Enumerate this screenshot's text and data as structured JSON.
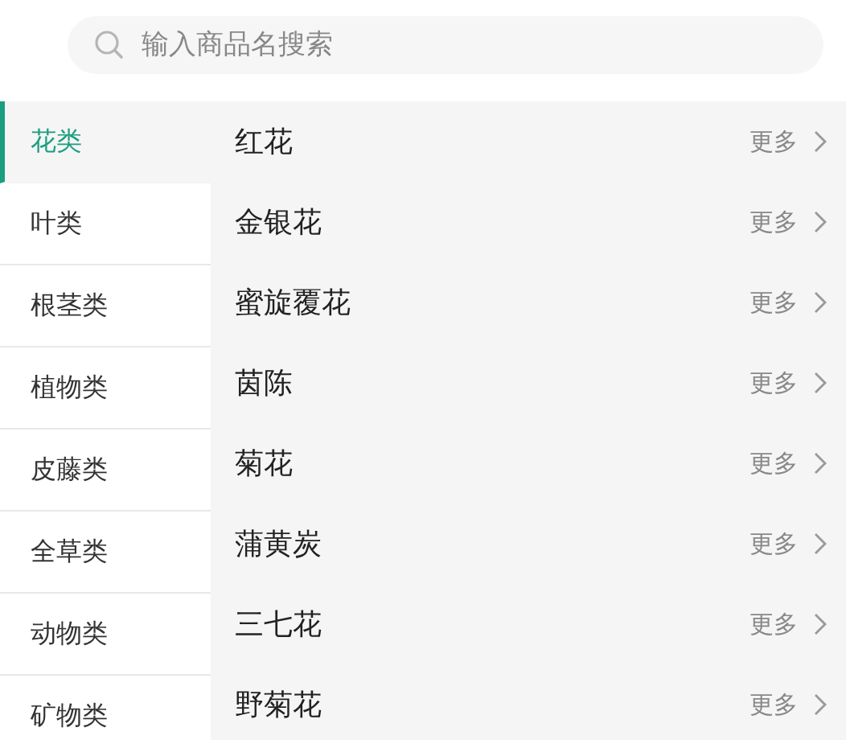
{
  "search": {
    "placeholder": "输入商品名搜索"
  },
  "categories": [
    {
      "label": "花类",
      "selected": true
    },
    {
      "label": "叶类",
      "selected": false
    },
    {
      "label": "根茎类",
      "selected": false
    },
    {
      "label": "植物类",
      "selected": false
    },
    {
      "label": "皮藤类",
      "selected": false
    },
    {
      "label": "全草类",
      "selected": false
    },
    {
      "label": "动物类",
      "selected": false
    },
    {
      "label": "矿物类",
      "selected": false
    }
  ],
  "products": [
    {
      "name": "红花",
      "more": "更多"
    },
    {
      "name": "金银花",
      "more": "更多"
    },
    {
      "name": "蜜旋覆花",
      "more": "更多"
    },
    {
      "name": "茵陈",
      "more": "更多"
    },
    {
      "name": "菊花",
      "more": "更多"
    },
    {
      "name": "蒲黄炭",
      "more": "更多"
    },
    {
      "name": "三七花",
      "more": "更多"
    },
    {
      "name": "野菊花",
      "more": "更多"
    }
  ]
}
